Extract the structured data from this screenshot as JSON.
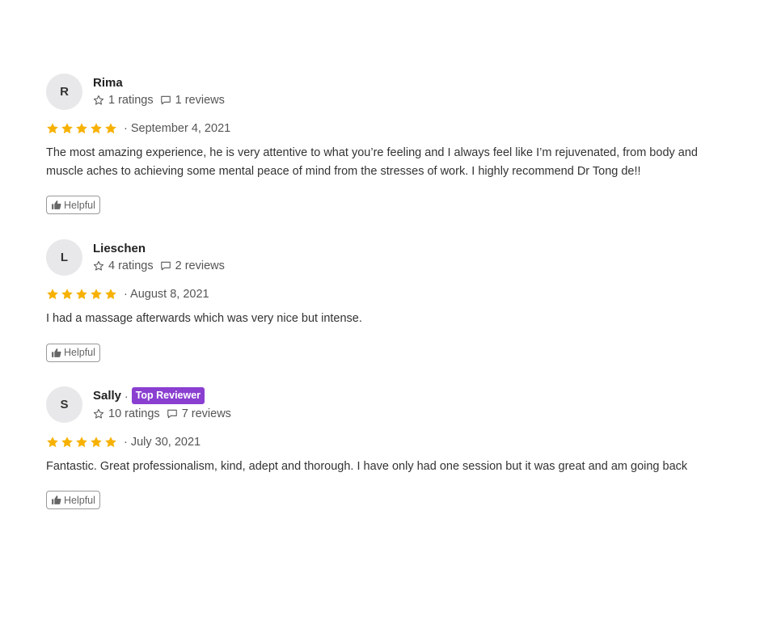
{
  "colors": {
    "star": "#f7b100",
    "badge": "#8a3fd1",
    "avatar_bg": "#e8e8ea"
  },
  "icons": {
    "ratings": "star-outline-icon",
    "reviews": "speech-bubble-icon",
    "helpful": "thumbs-up-icon",
    "rating_star": "star-filled-icon"
  },
  "reviews": [
    {
      "initial": "R",
      "name": "Rima",
      "badge": "",
      "ratings": "1 ratings",
      "reviews": "1 reviews",
      "stars": 5,
      "date": "· September 4, 2021",
      "text": "The most amazing experience, he is very attentive to what you’re feeling and I always feel like I’m rejuvenated, from body and muscle aches to achieving some mental peace of mind from the stresses of work. I highly recommend Dr Tong de!!",
      "helpful": "Helpful"
    },
    {
      "initial": "L",
      "name": "Lieschen",
      "badge": "",
      "ratings": "4 ratings",
      "reviews": "2 reviews",
      "stars": 5,
      "date": "· August 8, 2021",
      "text": "I had a massage afterwards which was very nice but intense.",
      "helpful": "Helpful"
    },
    {
      "initial": "S",
      "name": "Sally",
      "name_sep": "·",
      "badge": "Top Reviewer",
      "ratings": "10 ratings",
      "reviews": "7 reviews",
      "stars": 5,
      "date": "· July 30, 2021",
      "text": "Fantastic. Great professionalism, kind, adept and thorough. I have only had one session but it was great and am going back",
      "helpful": "Helpful"
    }
  ]
}
